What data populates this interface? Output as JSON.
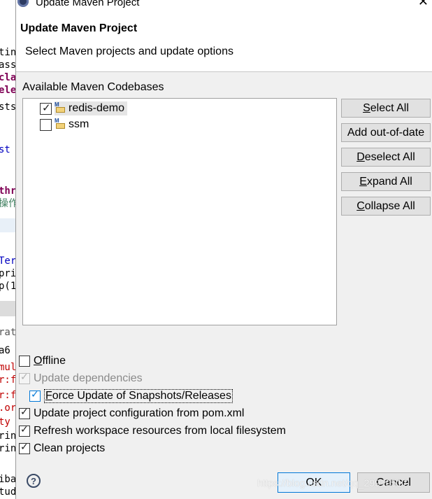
{
  "background_editor": {
    "lines": [
      {
        "text": "tin",
        "color": "#000000"
      },
      {
        "text": "ass",
        "color": "#000000"
      },
      {
        "text": "cla",
        "color": "#7f0055"
      },
      {
        "text": "ele",
        "color": "#7f0055"
      },
      {
        "text": "sts",
        "color": "#000000"
      },
      {
        "text": "st",
        "color": "#0000c0"
      },
      {
        "text": "thr",
        "color": "#7f0055"
      },
      {
        "text": "操作",
        "color": "#3f7f5f"
      },
      {
        "text": "Ter",
        "color": "#0000c0"
      },
      {
        "text": "pri",
        "color": "#000000"
      },
      {
        "text": "p(1",
        "color": "#000000"
      },
      {
        "text": "rati",
        "color": "#555555"
      },
      {
        "text": "a6",
        "color": "#000000"
      },
      {
        "text": "mul",
        "color": "#c00000"
      },
      {
        "text": "r:f",
        "color": "#c00000"
      },
      {
        "text": "r:f",
        "color": "#c00000"
      },
      {
        "text": ".or",
        "color": "#c00000"
      },
      {
        "text": "ty",
        "color": "#c00000"
      },
      {
        "text": "rin",
        "color": "#000000"
      },
      {
        "text": "rin",
        "color": "#000000"
      },
      {
        "text": "iba",
        "color": "#000000"
      },
      {
        "text": "tud",
        "color": "#000000"
      }
    ]
  },
  "window": {
    "title": "Update Maven Project",
    "close_glyph": "✕"
  },
  "header": {
    "title": "Update Maven Project",
    "description": "Select Maven projects and update options"
  },
  "codebases": {
    "label": "Available Maven Codebases",
    "items": [
      {
        "name": "redis-demo",
        "checked": true,
        "selected": true,
        "icon": "maven-project-icon"
      },
      {
        "name": "ssm",
        "checked": false,
        "selected": false,
        "icon": "maven-project-icon"
      }
    ]
  },
  "side_buttons": {
    "select_all": {
      "mnemonic": "S",
      "rest": "elect All"
    },
    "add_out_of_date": {
      "label": "Add out-of-date"
    },
    "deselect_all": {
      "mnemonic": "D",
      "rest": "eselect All"
    },
    "expand_all": {
      "mnemonic": "E",
      "rest": "xpand All"
    },
    "collapse_all": {
      "mnemonic": "C",
      "rest": "ollapse All"
    }
  },
  "options": {
    "offline": {
      "mnemonic": "O",
      "rest": "ffline",
      "checked": false,
      "enabled": true
    },
    "update_dependencies": {
      "label": "Update dependencies",
      "checked": true,
      "enabled": false
    },
    "force_update": {
      "mnemonic": "F",
      "rest": "orce Update of Snapshots/Releases",
      "checked": true,
      "enabled": true
    },
    "update_config": {
      "label": "Update project configuration from pom.xml",
      "checked": true,
      "enabled": true
    },
    "refresh_workspace": {
      "label": "Refresh workspace resources from local filesystem",
      "checked": true,
      "enabled": true
    },
    "clean_projects": {
      "label": "Clean projects",
      "checked": true,
      "enabled": true
    }
  },
  "footer": {
    "help_glyph": "?",
    "ok_label": "OK",
    "cancel_label": "Cancel",
    "watermark": "https://blog.csdn.net/qq_29919517"
  },
  "colors": {
    "dialog_bg": "#f0f0f0",
    "header_bg": "#ffffff",
    "default_button_border": "#0078d7",
    "selection_bg": "#e5e5e5"
  }
}
